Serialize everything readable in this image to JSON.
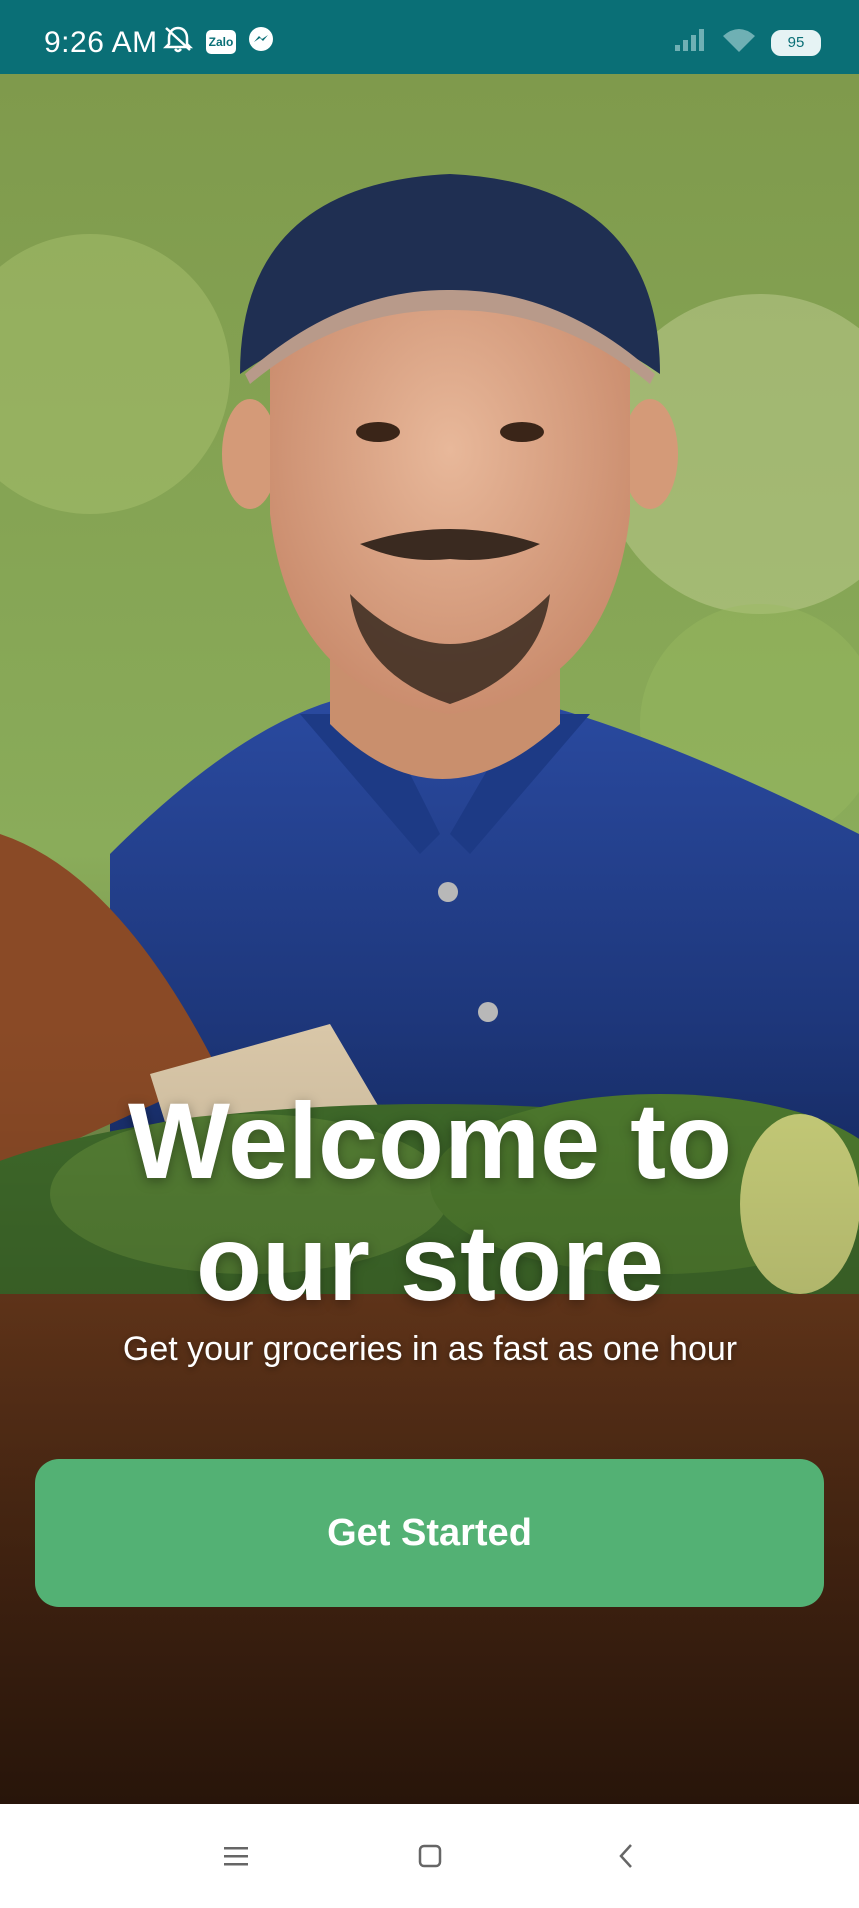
{
  "status_bar": {
    "time": "9:26 AM",
    "zalo_label": "Zalo",
    "battery": "95",
    "icons": [
      "mute-icon",
      "zalo-icon",
      "messenger-icon",
      "signal-icon",
      "wifi-icon",
      "battery-icon"
    ]
  },
  "welcome": {
    "title": "Welcome to our store",
    "subtitle": "Get your groceries in as fast as one hour"
  },
  "cta": {
    "label": "Get Started",
    "color": "#53b174"
  },
  "nav_bar": {
    "icons": [
      "menu-icon",
      "home-icon",
      "back-icon"
    ]
  },
  "colors": {
    "status_bar": "#0a6f76"
  }
}
